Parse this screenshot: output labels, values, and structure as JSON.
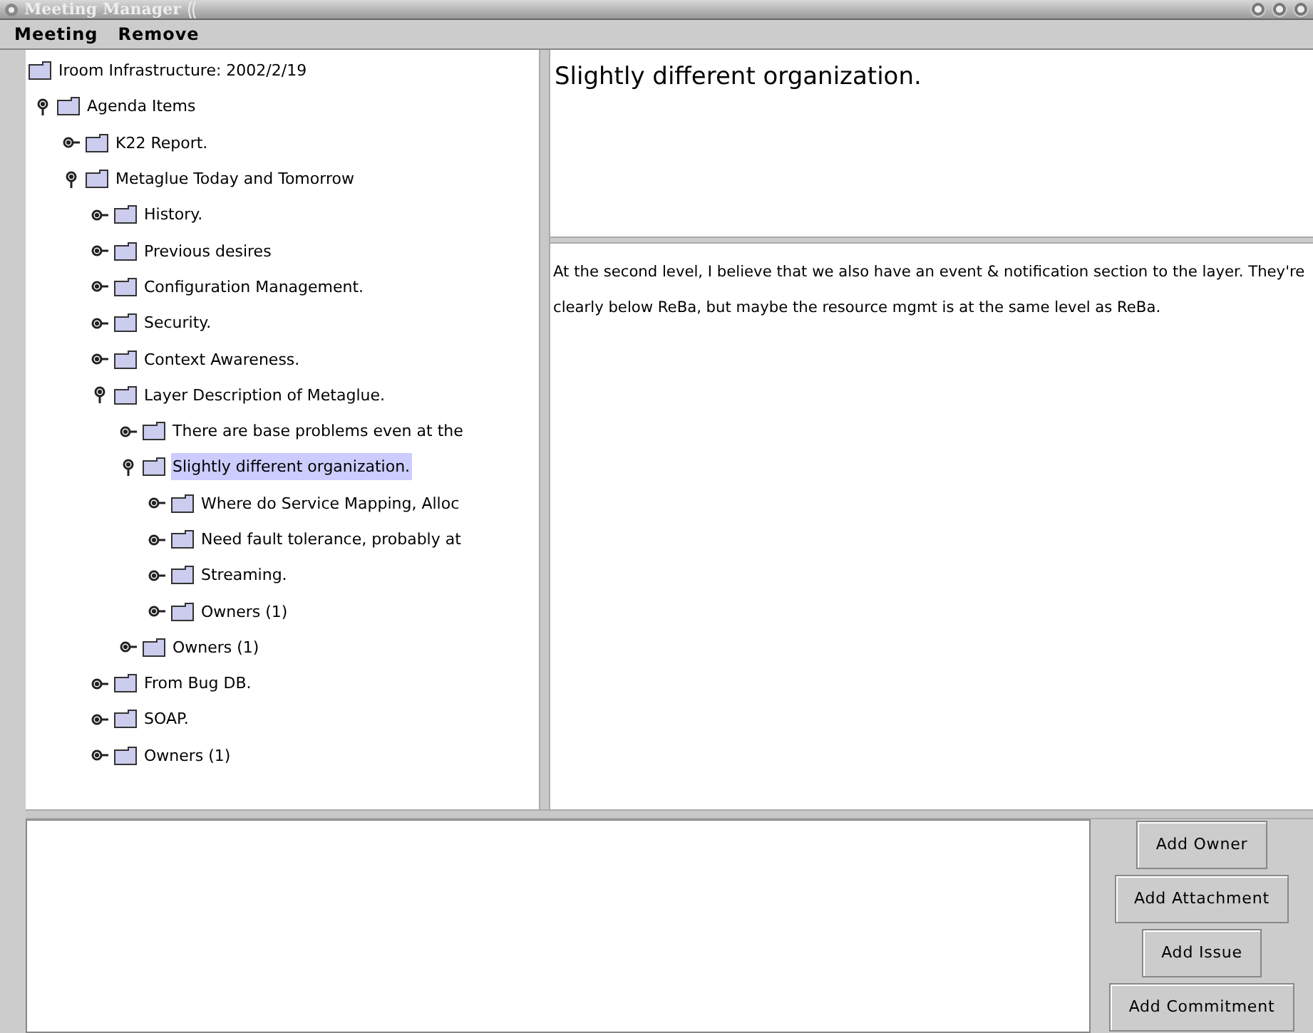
{
  "window": {
    "title": "Meeting Manager"
  },
  "menu": [
    "Meeting",
    "Remove"
  ],
  "tree": {
    "label": "Iroom Infrastructure: 2002/2/19",
    "selected": false,
    "children": [
      {
        "label": "Agenda Items",
        "expanded": true,
        "selected": false,
        "children": [
          {
            "label": "K22 Report.",
            "expanded": false,
            "selected": false
          },
          {
            "label": "Metaglue Today and Tomorrow",
            "expanded": true,
            "selected": false,
            "children": [
              {
                "label": "History.",
                "expanded": false,
                "selected": false
              },
              {
                "label": "Previous desires",
                "expanded": false,
                "selected": false
              },
              {
                "label": "Configuration Management.",
                "expanded": false,
                "selected": false
              },
              {
                "label": "Security.",
                "expanded": false,
                "selected": false
              },
              {
                "label": "Context Awareness.",
                "expanded": false,
                "selected": false
              },
              {
                "label": "Layer Description of Metaglue.",
                "expanded": true,
                "selected": false,
                "children": [
                  {
                    "label": "There are base problems even at the",
                    "expanded": false,
                    "selected": false
                  },
                  {
                    "label": "Slightly different organization.",
                    "expanded": true,
                    "selected": true,
                    "children": [
                      {
                        "label": "Where do Service Mapping, Alloc",
                        "expanded": false,
                        "selected": false
                      },
                      {
                        "label": "Need fault tolerance, probably at",
                        "expanded": false,
                        "selected": false
                      },
                      {
                        "label": "Streaming.",
                        "expanded": false,
                        "selected": false
                      },
                      {
                        "label": "Owners (1)",
                        "expanded": false,
                        "selected": false
                      }
                    ]
                  },
                  {
                    "label": "Owners (1)",
                    "expanded": false,
                    "selected": false
                  }
                ]
              },
              {
                "label": "From Bug DB.",
                "expanded": false,
                "selected": false
              },
              {
                "label": "SOAP.",
                "expanded": false,
                "selected": false
              },
              {
                "label": "Owners (1)",
                "expanded": false,
                "selected": false
              }
            ]
          }
        ]
      }
    ]
  },
  "detail": {
    "title": "Slightly different organization.",
    "body": "At the second level, I believe that we also have an event & notification section to the layer.  They're clearly below ReBa, but maybe the resource mgmt is at the same level as ReBa."
  },
  "buttons": [
    "Add Owner",
    "Add Attachment",
    "Add Issue",
    "Add Commitment"
  ]
}
